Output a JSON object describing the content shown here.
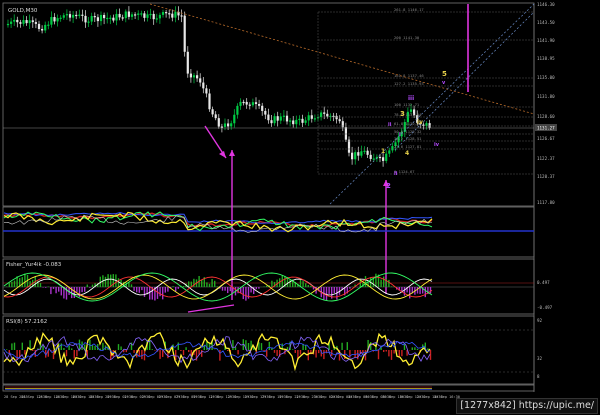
{
  "main": {
    "symbol": "GOLD,M30",
    "price_scale": [
      "1146.30",
      "1143.50",
      "1141.90",
      "1138.95",
      "1135.00",
      "1131.80",
      "1128.60",
      "1126.67",
      "1122.37",
      "1120.37",
      "1117.80"
    ],
    "current_price": "1131.27",
    "fib_levels": [
      "261.8 1146.17",
      "200 1141.30",
      "161.8 1137.46",
      "127.2 1135.93",
      "100 1132.71",
      "78.6 1131.54",
      "61.8 1130.53",
      "50.0 1129.32",
      "38.2 1128.51",
      "23.6 1127.81",
      "0 1124.67"
    ],
    "wave_labels": [
      "5",
      "3",
      "iii",
      "iv",
      "v",
      "ii",
      "i",
      "4",
      "2",
      "1",
      "ii",
      "iv"
    ],
    "colors": {
      "up": "#00cc44",
      "down": "#e8e8e8",
      "wave_yellow": "#e6d04a",
      "wave_purple": "#b54bff",
      "arrow": "#e035e0",
      "trend": "#b86b2a",
      "channel": "#6a8cc8"
    }
  },
  "indicator1": {
    "name": ""
  },
  "indicator2": {
    "name": "Fisher_Yur4ik -0.083",
    "scale": [
      "0.497",
      "-0.497"
    ]
  },
  "indicator3": {
    "name": "RSI(8) 57.2162",
    "scale": [
      "92",
      "8",
      "32"
    ]
  },
  "time_axis": [
    "28 Sep 2015",
    "28 Sep 12:30",
    "28 Sep 14:30",
    "28 Sep 16:30",
    "28 Sep 18:30",
    "28 Sep 20:30",
    "29 Sep 01:30",
    "29 Sep 03:30",
    "29 Sep 05:30",
    "29 Sep 07:30",
    "29 Sep 09:30",
    "29 Sep 11:30",
    "29 Sep 13:30",
    "29 Sep 15:30",
    "29 Sep 17:30",
    "29 Sep 19:30",
    "29 Sep 21:30",
    "29 Sep 23:30",
    "30 Sep 02:30",
    "30 Sep 04:30",
    "30 Sep 06:30",
    "30 Sep 08:30",
    "30 Sep 10:30",
    "30 Sep 12:30",
    "30 Sep 14:30",
    "30 Sep 16:30"
  ],
  "watermark": "[1277x842] https://upic.me/"
}
